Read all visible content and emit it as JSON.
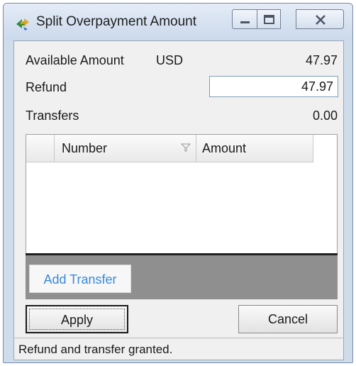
{
  "window": {
    "title": "Split Overpayment Amount"
  },
  "fields": {
    "available_label": "Available Amount",
    "currency": "USD",
    "available_value": "47.97",
    "refund_label": "Refund",
    "refund_value": "47.97",
    "transfers_label": "Transfers",
    "transfers_value": "0.00"
  },
  "grid": {
    "columns": [
      "Number",
      "Amount"
    ],
    "rows": []
  },
  "buttons": {
    "add_transfer": "Add Transfer",
    "apply": "Apply",
    "cancel": "Cancel"
  },
  "status": {
    "message": "Refund and transfer granted."
  },
  "colors": {
    "link_blue": "#3a8ad8",
    "footer_gray": "#8f8f8f",
    "chrome_blue": "#cfdcec"
  },
  "icons": {
    "app": "split-payment-arrows-icon",
    "minimize": "minimize-icon",
    "maximize": "maximize-icon",
    "close": "close-icon",
    "filter": "filter-icon"
  }
}
